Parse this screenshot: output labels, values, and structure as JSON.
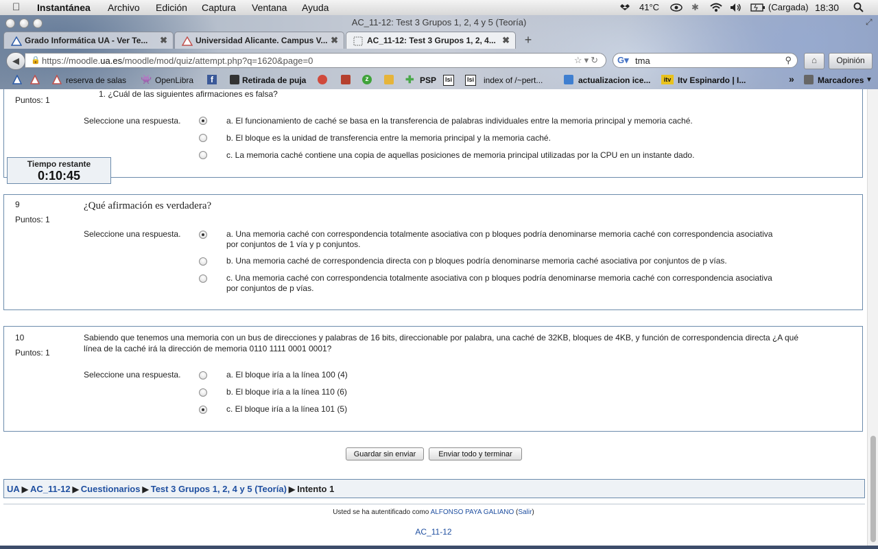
{
  "menubar": {
    "app_name": "Instantánea",
    "menus": [
      "Archivo",
      "Edición",
      "Captura",
      "Ventana",
      "Ayuda"
    ],
    "temperature": "41°C",
    "battery": "(Cargada)",
    "clock": "18:30"
  },
  "browser": {
    "window_title": "AC_11-12: Test 3 Grupos 1, 2, 4 y 5 (Teoría)",
    "tabs": [
      {
        "label": "Grado Informática UA - Ver Te..."
      },
      {
        "label": "Universidad Alicante. Campus V..."
      },
      {
        "label": "AC_11-12: Test 3 Grupos 1, 2, 4..."
      }
    ],
    "url_scheme": "https://moodle.",
    "url_host": "ua.es",
    "url_path": "/moodle/mod/quiz/attempt.php?q=1620&page=0",
    "search_value": "tma",
    "opinion_label": "Opinión",
    "bookmarks": [
      "reserva de salas",
      "OpenLibra",
      "Retirada de puja",
      "PSP",
      "index of /~pert...",
      "actualizacion ice...",
      "Itv Espinardo | I..."
    ],
    "bookmarks_overflow": "»",
    "bookmarks_menu": "Marcadores"
  },
  "timer": {
    "label": "Tiempo restante",
    "value": "0:10:45"
  },
  "common": {
    "points": "Puntos: 1",
    "select_prompt": "Seleccione una respuesta."
  },
  "q8": {
    "text": "1.  ¿Cuál de las siguientes afirmaciones es falsa?",
    "options": [
      {
        "text": "a. El funcionamiento de caché se basa en la transferencia de palabras individuales entre la memoria principal y memoria caché.",
        "checked": true
      },
      {
        "text": "b. El bloque es la unidad de transferencia entre la memoria principal y la memoria caché.",
        "checked": false
      },
      {
        "text": "c. La memoria caché contiene una copia de aquellas posiciones de memoria principal utilizadas por la CPU en un instante dado.",
        "checked": false
      }
    ]
  },
  "q9": {
    "number": "9",
    "text": "¿Qué afirmación es verdadera?",
    "options": [
      {
        "text": "a. Una memoria caché con correspondencia totalmente asociativa con p bloques podría denominarse memoria caché con correspondencia asociativa por conjuntos de 1 vía y p conjuntos.",
        "checked": true
      },
      {
        "text": "b. Una memoria caché de correspondencia directa con p bloques podría denominarse memoria caché asociativa por conjuntos de p vías.",
        "checked": false
      },
      {
        "text": "c. Una memoria caché con correspondencia totalmente asociativa con p bloques podría denominarse memoria caché con correspondencia asociativa por conjuntos de p vías.",
        "checked": false
      }
    ]
  },
  "q10": {
    "number": "10",
    "text": "Sabiendo que tenemos una memoria con un bus de direcciones y palabras de 16 bits, direccionable por palabra, una caché de 32KB, bloques de 4KB, y función de correspondencia directa ¿A qué línea de la caché irá la dirección de memoria 0110 1111 0001 0001?",
    "options": [
      {
        "text": "a. El bloque iría a la línea 100 (4)",
        "checked": false
      },
      {
        "text": "b. El bloque iría a la línea 110 (6)",
        "checked": false
      },
      {
        "text": "c. El bloque iría a la línea 101 (5)",
        "checked": true
      }
    ]
  },
  "buttons": {
    "save": "Guardar sin enviar",
    "submit": "Enviar todo y terminar"
  },
  "breadcrumb": {
    "items": [
      "UA",
      "AC_11-12",
      "Cuestionarios",
      "Test 3 Grupos 1, 2, 4 y 5 (Teoría)"
    ],
    "current": "Intento 1",
    "separator": "▶"
  },
  "footer": {
    "login_prefix": "Usted se ha autentificado como",
    "user": "ALFONSO PAYA GALIANO",
    "logout": "Salir",
    "course": "AC_11-12"
  }
}
